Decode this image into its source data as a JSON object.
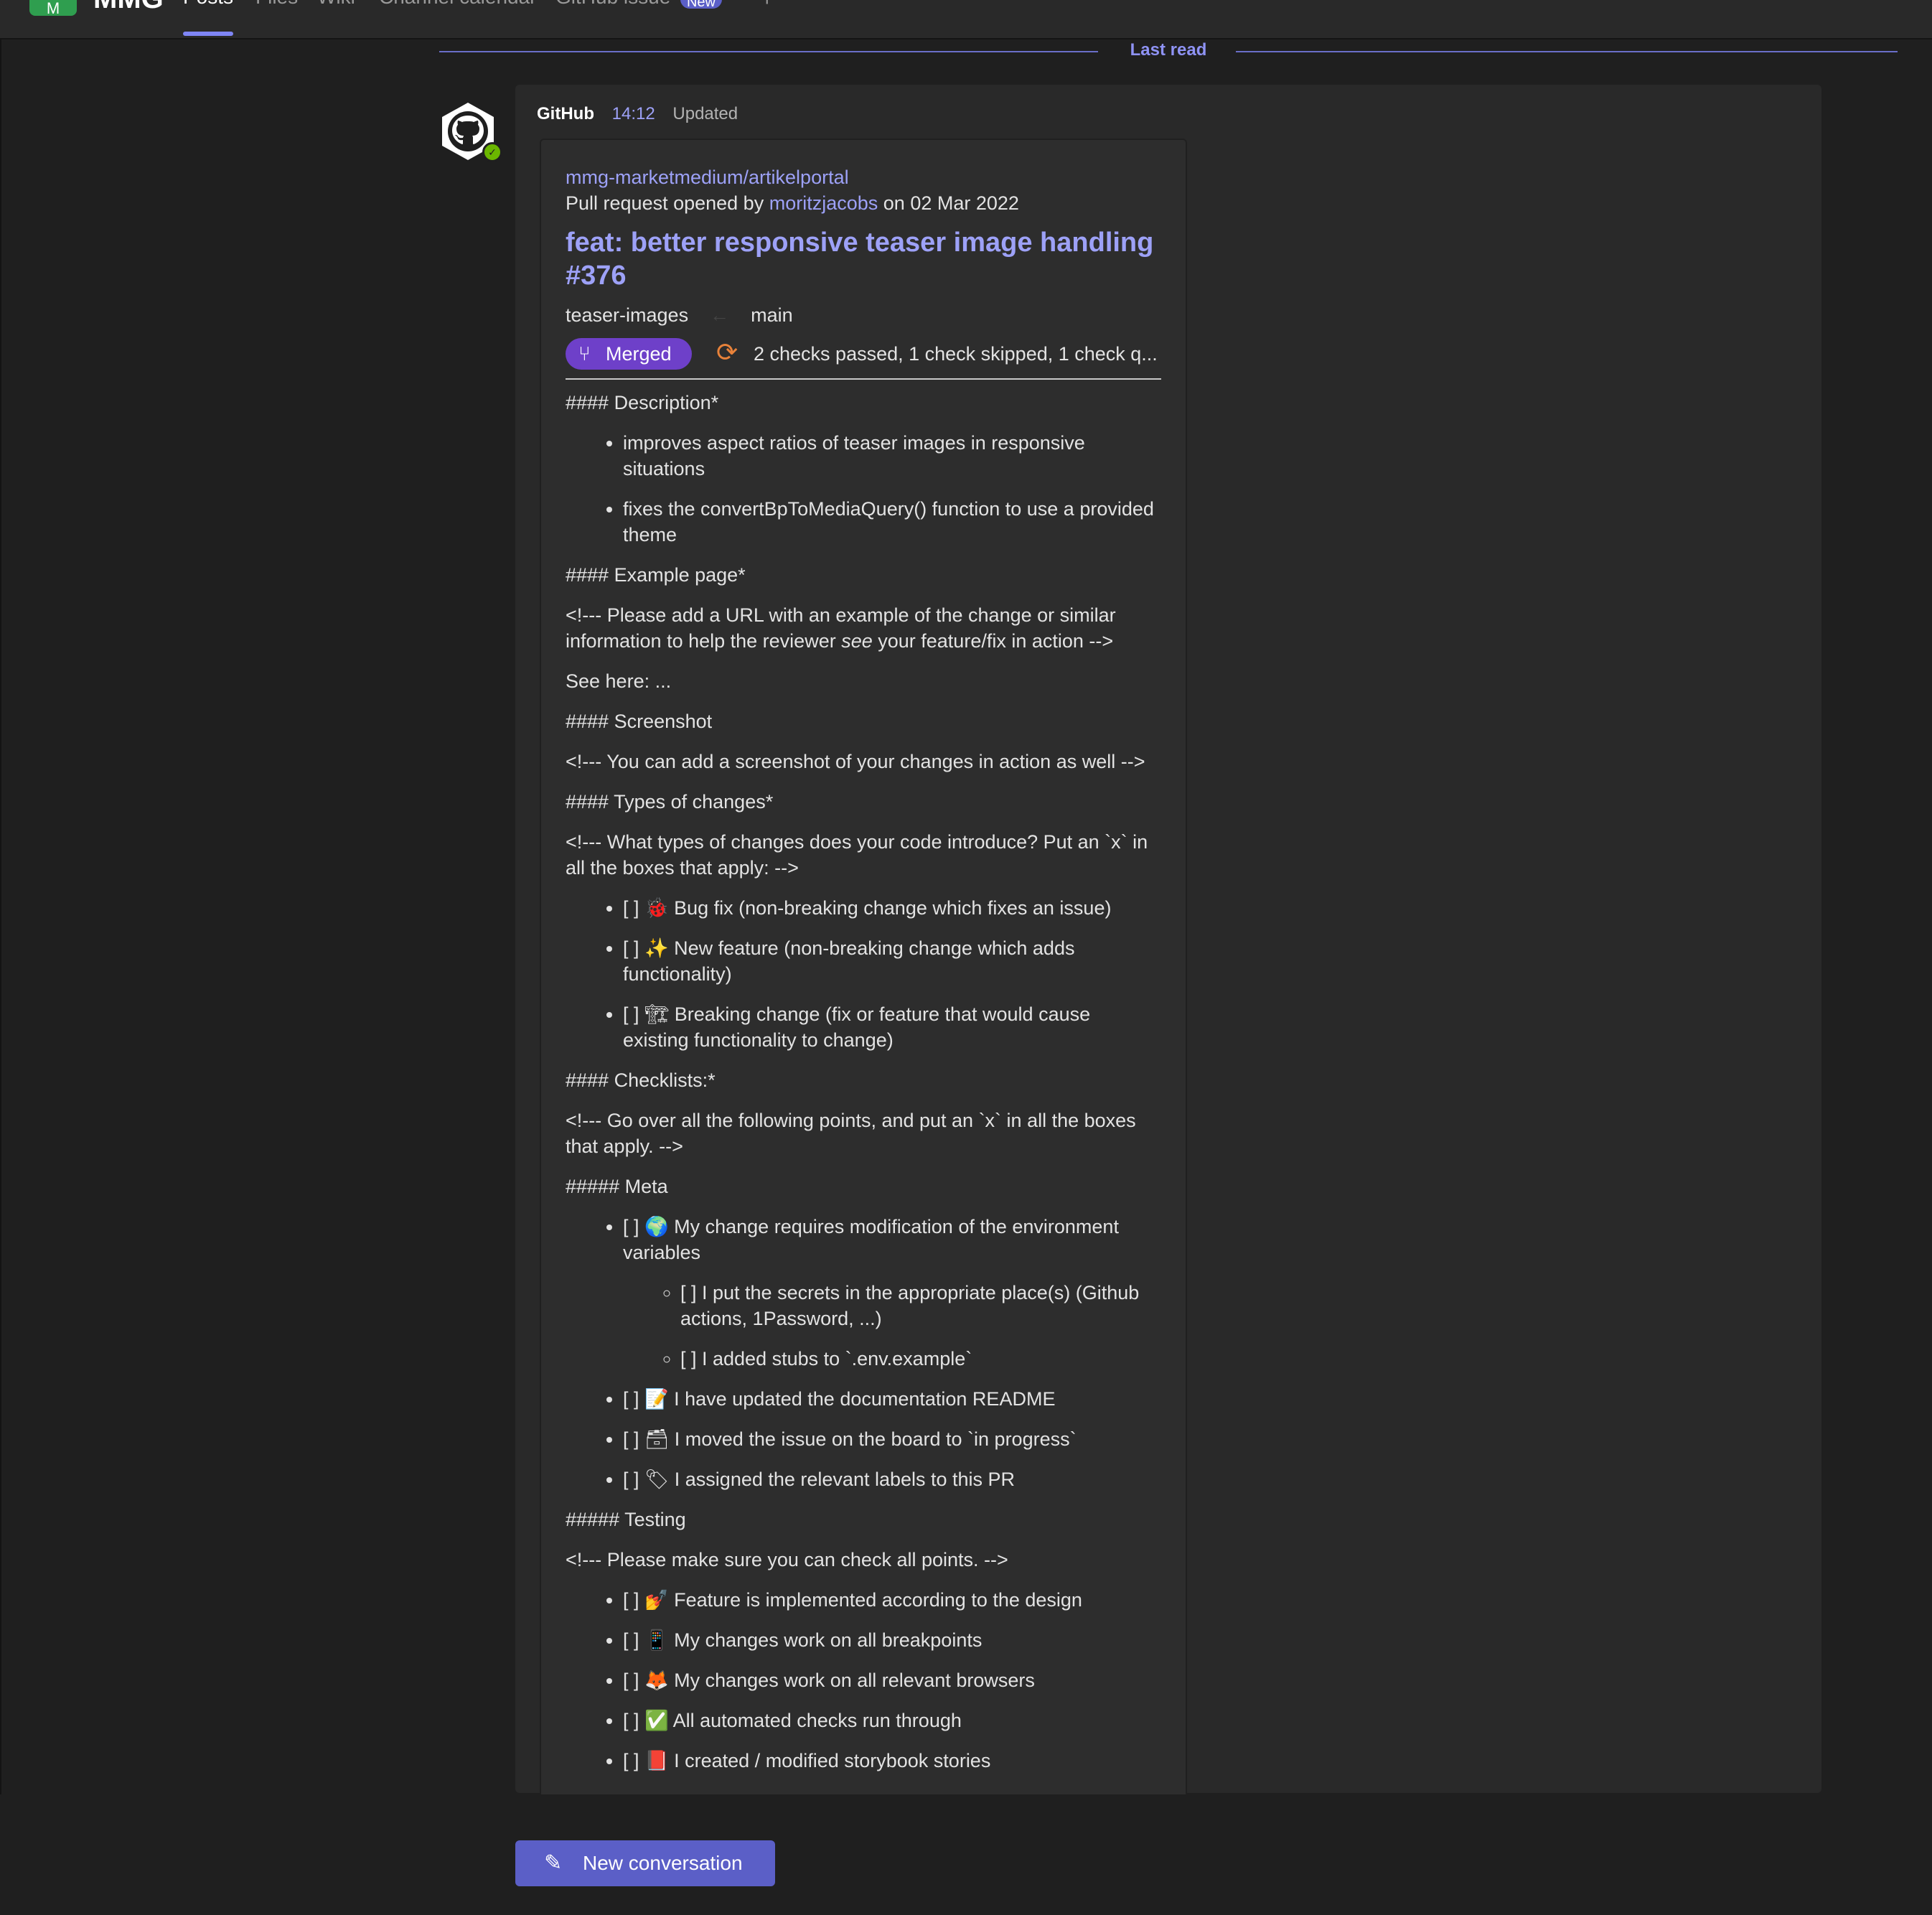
{
  "topbar": {
    "team_initials": "M",
    "team_name": "MMG",
    "tabs": [
      {
        "label": "Posts",
        "active": true
      },
      {
        "label": "Files"
      },
      {
        "label": "Wiki"
      },
      {
        "label": "Channel calendar"
      },
      {
        "label": "GitHub issue"
      }
    ],
    "new_badge": "New",
    "add_tab": "+"
  },
  "last_read": "Last read",
  "message": {
    "sender": "GitHub",
    "time": "14:12",
    "edited": "Updated",
    "presence_icon": "check-icon"
  },
  "card": {
    "repo": "mmg-marketmedium/artikelportal",
    "opened_prefix": "Pull request opened by",
    "author": "moritzjacobs",
    "opened_suffix": "on 02 Mar 2022",
    "title": "feat: better responsive teaser image handling #376",
    "head_branch": "teaser-images",
    "base_branch": "main",
    "status": "Merged",
    "checks": "2 checks passed, 1 check skipped, 1 check q...",
    "body": {
      "h_description": "#### Description*",
      "desc_1": "improves aspect ratios of teaser images in responsive situations",
      "desc_2": "fixes the convertBpToMediaQuery() function to use a provided theme",
      "h_example": "#### Example page*",
      "example_comment_a": "<!--- Please add a URL with an example of the change or similar information to help the reviewer ",
      "example_comment_em": "see",
      "example_comment_b": " your feature/fix in action -->",
      "see_here": "See here: ...",
      "h_screenshot": "#### Screenshot",
      "screenshot_comment": "<!--- You can add a screenshot of your changes in action as well -->",
      "h_types": "#### Types of changes*",
      "types_comment": "<!--- What types of changes does your code introduce? Put an `x` in all the boxes that apply: -->",
      "type_1": "[ ] 🐞 Bug fix (non-breaking change which fixes an issue)",
      "type_2": "[ ] ✨ New feature (non-breaking change which adds functionality)",
      "type_3": "[ ] 🏗 Breaking change (fix or feature that would cause existing functionality to change)",
      "h_checklists": "#### Checklists:*",
      "checklists_comment": "<!--- Go over all the following points, and put an `x` in all the boxes that apply. -->",
      "h_meta": "##### Meta",
      "meta_1": "[ ] 🌍 My change requires modification of the environment variables",
      "meta_1a": "[ ] I put the secrets in the appropriate place(s) (Github actions, 1Password, ...)",
      "meta_1b": "[ ] I added stubs to `.env.example`",
      "meta_2": "[ ] 📝 I have updated the documentation README",
      "meta_3": "[ ] 🗃 I moved the issue on the board to `in progress`",
      "meta_4": "[ ] 🏷 I assigned the relevant labels to this PR",
      "h_testing": "##### Testing",
      "testing_comment": "<!--- Please make sure you can check all points. -->",
      "test_1": "[ ] 💅 Feature is implemented according to the design",
      "test_2": "[ ] 📱 My changes work on all breakpoints",
      "test_3": "[ ] 🦊 My changes work on all relevant browsers",
      "test_4": "[ ] ✅ All automated checks run through",
      "test_5": "[ ] 📕 I created / modified storybook stories"
    }
  },
  "new_conversation": "New conversation",
  "icons": {
    "avatar": "github-octocat-icon",
    "merge": "git-merge-icon",
    "checks": "refresh-icon",
    "compose": "compose-icon"
  },
  "colors": {
    "accent": "#5b5fc7",
    "link": "#9da1f7",
    "merged": "#6e40c9",
    "checks_pending": "#e8823a",
    "presence": "#6bb700",
    "team": "#2f9e4f"
  }
}
